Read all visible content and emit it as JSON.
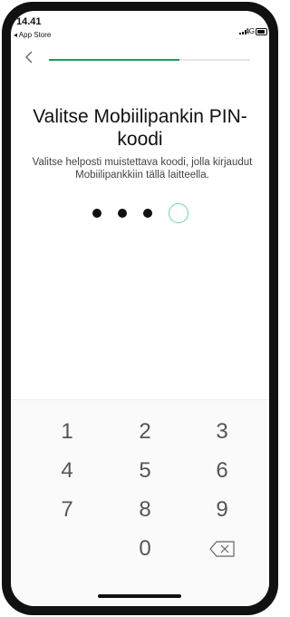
{
  "status_bar": {
    "time": "14.41",
    "back_app": "◂ App Store",
    "network": "4G",
    "signal_icon": "signal-bars-icon",
    "battery_icon": "battery-icon"
  },
  "nav": {
    "back_icon": "chevron-left-icon",
    "progress_fraction": 0.65
  },
  "title": "Valitse Mobiilipankin PIN-koodi",
  "subtitle": "Valitse  helposti muistettava koodi, jolla kirjaudut Mobiilipankkiin tällä laitteella.",
  "pin": {
    "filled": 3,
    "total": 4
  },
  "keypad": {
    "keys": [
      "1",
      "2",
      "3",
      "4",
      "5",
      "6",
      "7",
      "8",
      "9",
      "0"
    ],
    "delete_icon": "backspace-icon"
  },
  "colors": {
    "accent": "#1a9e5a",
    "empty_dot_border": "#6dd6a3",
    "text": "#111111"
  }
}
